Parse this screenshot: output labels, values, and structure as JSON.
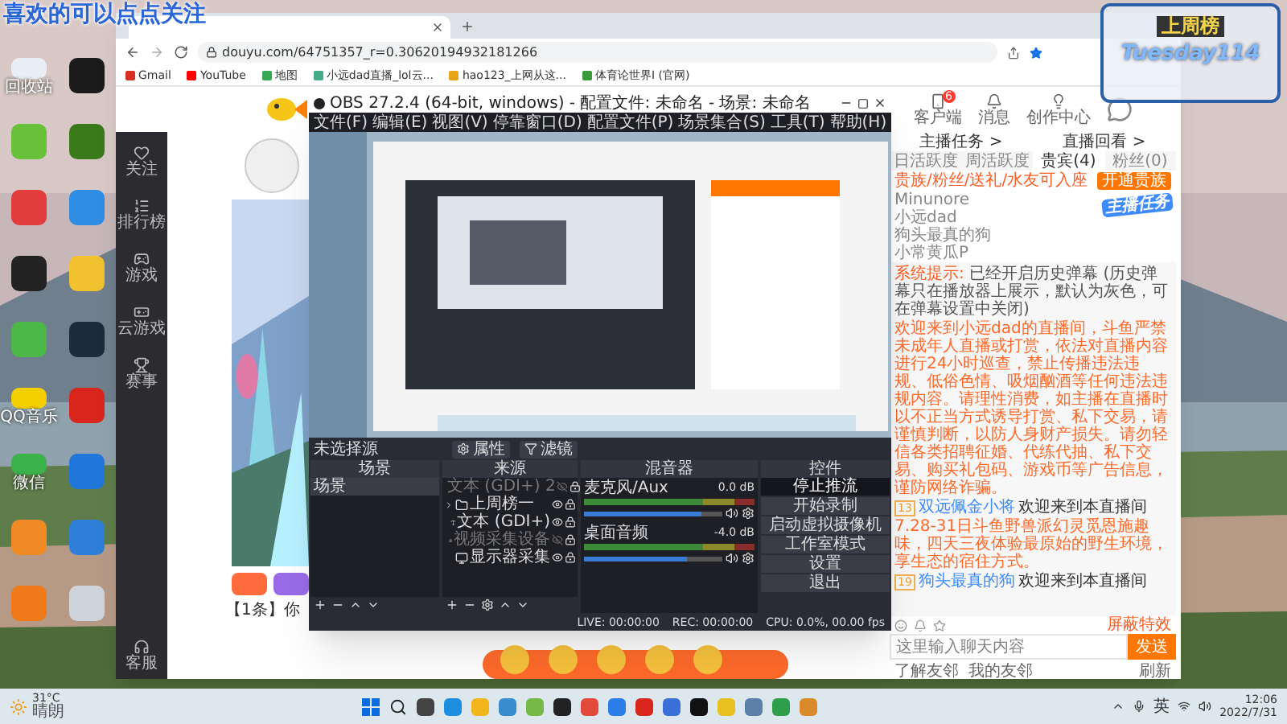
{
  "overlays": {
    "follow_text": "喜欢的可以点点关注",
    "weekly_title": "上周榜",
    "weekly_name": "Tuesday114"
  },
  "desktop_icons": [
    {
      "label": "回收站"
    },
    {
      "label": "QQ音乐"
    },
    {
      "label": "微信"
    }
  ],
  "browser": {
    "url": "douyu.com/64751357_r=0.30620194932181266",
    "bookmarks": [
      {
        "label": "Gmail"
      },
      {
        "label": "YouTube"
      },
      {
        "label": "地图"
      },
      {
        "label": "小远dad直播_lol云..."
      },
      {
        "label": "hao123_上网从这..."
      },
      {
        "label": "体育论世界I (官网)"
      }
    ]
  },
  "douyu": {
    "sidebar": [
      {
        "label": "关注"
      },
      {
        "label": "排行榜"
      },
      {
        "label": "游戏"
      },
      {
        "label": "云游戏"
      },
      {
        "label": "赛事"
      }
    ],
    "sidebar_bottom": "客服",
    "header_links": [
      {
        "label": "客户端",
        "badge": "6"
      },
      {
        "label": "消息"
      },
      {
        "label": "创作中心"
      }
    ],
    "gift_notice": "【1条】你",
    "quick_links": [
      "主播任务 >",
      "直播回看 >"
    ],
    "rank_tabs": [
      {
        "label": "日活跃度",
        "selected": false
      },
      {
        "label": "周活跃度",
        "selected": false
      },
      {
        "label": "贵宾(4)",
        "selected": true
      },
      {
        "label": "粉丝(0)",
        "selected": false
      }
    ],
    "vip_note": "贵族/粉丝/送礼/水友可入座",
    "vip_button": "开通贵族",
    "vip_list": [
      "Minunore",
      "小远dad",
      "狗头最真的狗",
      "小常黄瓜P"
    ],
    "task_badge": "主播任务",
    "chat": [
      {
        "kind": "system",
        "label": "系统提示:",
        "text": "已经开启历史弹幕 (历史弹幕只在播放器上展示，默认为灰色，可在弹幕设置中关闭)"
      },
      {
        "kind": "notice",
        "text": "欢迎来到小远dad的直播间，斗鱼严禁未成年人直播或打赏，依法对直播内容进行24小时巡查，禁止传播违法违规、低俗色情、吸烟酗酒等任何违法违规内容。请理性消费，如主播在直播时以不正当方式诱导打赏、私下交易，请谨慎判断，以防人身财产损失。请勿轻信各类招聘征婚、代练代抽、私下交易、购买礼包码、游戏币等广告信息，谨防网络诈骗。"
      },
      {
        "kind": "enter",
        "badge": "13",
        "user": "双远佩金小将",
        "text": "欢迎来到本直播间"
      },
      {
        "kind": "notice",
        "text": "7.28-31日斗鱼野兽派幻灵觅恩施趣味，四天三夜体验最原始的野生环境，享生态的宿住方式。"
      },
      {
        "kind": "enter",
        "badge": "19",
        "user": "狗头最真的狗",
        "text": "欢迎来到本直播间"
      }
    ],
    "chat_effects": "屏蔽特效",
    "chat_input": {
      "placeholder": "这里输入聊天内容"
    },
    "send_button": "发送",
    "friends": {
      "about": "了解友邻",
      "mine": "我的友邻",
      "refresh": "刷新"
    }
  },
  "obs": {
    "title": "OBS 27.2.4 (64-bit, windows) - 配置文件: 未命名 - 场景: 未命名",
    "menu": [
      "文件(F)",
      "编辑(E)",
      "视图(V)",
      "停靠窗口(D)",
      "配置文件(P)",
      "场景集合(S)",
      "工具(T)",
      "帮助(H)"
    ],
    "no_source": "未选择源",
    "properties": "属性",
    "filters": "滤镜",
    "docks": [
      "场景",
      "来源",
      "混音器",
      "控件"
    ],
    "scenes": [
      {
        "name": "场景",
        "selected": true
      }
    ],
    "sources": [
      {
        "kind": "text",
        "name": "文本 (GDI+) 2",
        "visible": false
      },
      {
        "kind": "group",
        "name": "上周榜一",
        "visible": true
      },
      {
        "kind": "text",
        "name": "文本 (GDI+)",
        "visible": true
      },
      {
        "kind": "camera",
        "name": "视频采集设备",
        "visible": false
      },
      {
        "kind": "display",
        "name": "显示器采集",
        "visible": true
      }
    ],
    "mixer": [
      {
        "name": "麦克风/Aux",
        "reading": "0.0 dB",
        "level": 0.85
      },
      {
        "name": "桌面音频",
        "reading": "-4.0 dB",
        "level": 0.74
      }
    ],
    "controls": [
      {
        "label": "停止推流",
        "active": true
      },
      {
        "label": "开始录制",
        "active": false
      },
      {
        "label": "启动虚拟摄像机",
        "active": false
      },
      {
        "label": "工作室模式",
        "active": false
      },
      {
        "label": "设置",
        "active": false
      },
      {
        "label": "退出",
        "active": false
      }
    ],
    "status": {
      "live": "LIVE: 00:00:00",
      "rec": "REC: 00:00:00",
      "cpu": "CPU: 0.0%, 00.00 fps"
    }
  },
  "taskbar": {
    "temperature": "31°C",
    "weather": "晴朗",
    "ime": "英",
    "time": "12:06",
    "date": "2022/7/31"
  }
}
